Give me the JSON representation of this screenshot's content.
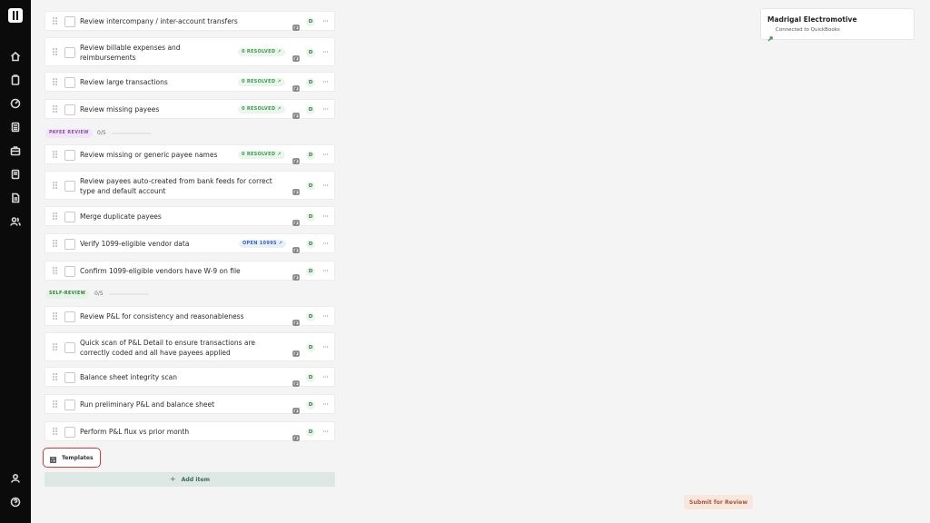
{
  "sections": {
    "payee_review": {
      "label": "PAYEE REVIEW",
      "count": "0/5"
    },
    "self_review": {
      "label": "SELF-REVIEW",
      "count": "0/5"
    }
  },
  "tasks": [
    {
      "label": "Review intercompany / inter-account transfers",
      "badge": "",
      "assignee": "D"
    },
    {
      "label": "Review billable expenses and reimbursements",
      "badge": "0 RESOLVED",
      "assignee": "D"
    },
    {
      "label": "Review large transactions",
      "badge": "0 RESOLVED",
      "assignee": "D"
    },
    {
      "label": "Review missing payees",
      "badge": "0 RESOLVED",
      "assignee": "D"
    },
    {
      "label": "Review missing or generic payee names",
      "badge": "0 RESOLVED",
      "assignee": "D"
    },
    {
      "label": "Review payees auto-created from bank feeds for correct type and default account",
      "badge": "",
      "assignee": "D"
    },
    {
      "label": "Merge duplicate payees",
      "badge": "",
      "assignee": "D"
    },
    {
      "label": "Verify 1099-eligible vendor data",
      "badge": "OPEN 1099S",
      "assignee": "D"
    },
    {
      "label": "Confirm 1099-eligible vendors have W-9 on file",
      "badge": "",
      "assignee": "D"
    },
    {
      "label": "Review P&L for consistency and reasonableness",
      "badge": "",
      "assignee": "D"
    },
    {
      "label": "Quick scan of P&L Detail to ensure transactions are correctly coded and all have payees applied",
      "badge": "",
      "assignee": "D"
    },
    {
      "label": "Balance sheet integrity scan",
      "badge": "",
      "assignee": "D"
    },
    {
      "label": "Run preliminary P&L and balance sheet",
      "badge": "",
      "assignee": "D"
    },
    {
      "label": "Perform P&L flux vs prior month",
      "badge": "",
      "assignee": "D"
    }
  ],
  "buttons": {
    "templates": "Templates",
    "add_item": "Add item",
    "submit": "Submit for Review"
  },
  "company": {
    "name": "Madrigal Electromotive",
    "status": "Connected to QuickBooks"
  },
  "colors": {
    "sidebar": "#0b0b0b",
    "resolved": "#3f9b54",
    "open": "#2e63c7",
    "highlight": "#d43a3a"
  }
}
